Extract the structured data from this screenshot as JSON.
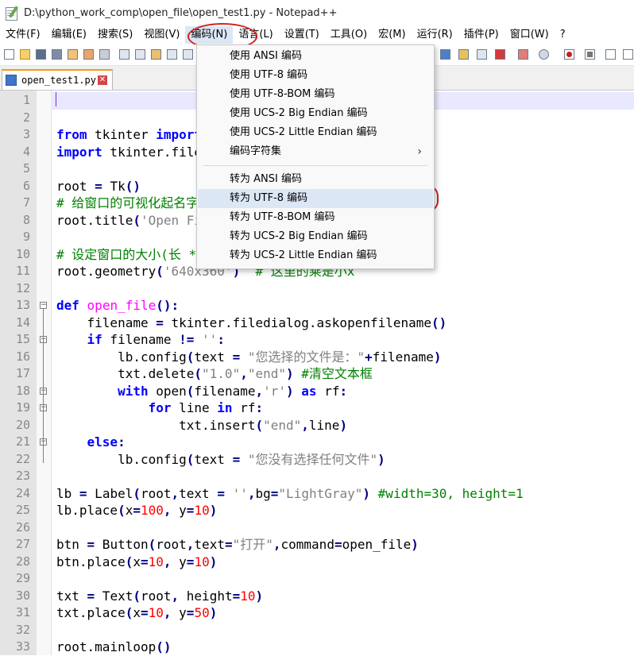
{
  "window": {
    "title": "D:\\python_work_comp\\open_file\\open_test1.py - Notepad++"
  },
  "menubar": {
    "items": [
      {
        "label": "文件(F)"
      },
      {
        "label": "编辑(E)"
      },
      {
        "label": "搜索(S)"
      },
      {
        "label": "视图(V)"
      },
      {
        "label": "编码(N)"
      },
      {
        "label": "语言(L)"
      },
      {
        "label": "设置(T)"
      },
      {
        "label": "工具(O)"
      },
      {
        "label": "宏(M)"
      },
      {
        "label": "运行(R)"
      },
      {
        "label": "插件(P)"
      },
      {
        "label": "窗口(W)"
      },
      {
        "label": "?"
      }
    ]
  },
  "tab": {
    "label": "open_test1.py",
    "close": "✕"
  },
  "encoding_menu": {
    "items": [
      {
        "label": "使用 ANSI 编码"
      },
      {
        "label": "使用 UTF-8 编码"
      },
      {
        "label": "使用 UTF-8-BOM 编码"
      },
      {
        "label": "使用 UCS-2 Big Endian 编码"
      },
      {
        "label": "使用 UCS-2 Little Endian 编码"
      },
      {
        "label": "编码字符集",
        "arrow": "›"
      },
      {
        "label": "转为 ANSI 编码"
      },
      {
        "label": "转为 UTF-8 编码"
      },
      {
        "label": "转为 UTF-8-BOM 编码"
      },
      {
        "label": "转为 UCS-2 Big Endian 编码"
      },
      {
        "label": "转为 UCS-2 Little Endian 编码"
      }
    ]
  },
  "colors": {
    "keyword": "#0000ff",
    "function": "#ff00ff",
    "string": "#808080",
    "number": "#ff0000",
    "comment": "#008000",
    "annotation": "#d32020"
  },
  "editor": {
    "current_line": 1,
    "lines": [
      {
        "n": "1",
        "t": ""
      },
      {
        "n": "2",
        "t": ""
      },
      {
        "n": "3",
        "t": "from tkinter import *"
      },
      {
        "n": "4",
        "t": "import tkinter.filedialog"
      },
      {
        "n": "5",
        "t": ""
      },
      {
        "n": "6",
        "t": "root = Tk()"
      },
      {
        "n": "7",
        "t": "# 给窗口的可视化起名字"
      },
      {
        "n": "8",
        "t": "root.title('Open File')"
      },
      {
        "n": "9",
        "t": ""
      },
      {
        "n": "10",
        "t": "# 设定窗口的大小(长 * 宽)"
      },
      {
        "n": "11",
        "t": "root.geometry('640x360')  # 这里的乘是小x"
      },
      {
        "n": "12",
        "t": ""
      },
      {
        "n": "13",
        "t": "def open_file():"
      },
      {
        "n": "14",
        "t": "    filename = tkinter.filedialog.askopenfilename()"
      },
      {
        "n": "15",
        "t": "    if filename != '':"
      },
      {
        "n": "16",
        "t": "        lb.config(text = \"您选择的文件是：\"+filename)"
      },
      {
        "n": "17",
        "t": "        txt.delete(\"1.0\",\"end\") #清空文本框"
      },
      {
        "n": "18",
        "t": "        with open(filename,'r') as rf:"
      },
      {
        "n": "19",
        "t": "            for line in rf:"
      },
      {
        "n": "20",
        "t": "                txt.insert(\"end\",line)"
      },
      {
        "n": "21",
        "t": "    else:"
      },
      {
        "n": "22",
        "t": "        lb.config(text = \"您没有选择任何文件\")"
      },
      {
        "n": "23",
        "t": ""
      },
      {
        "n": "24",
        "t": "lb = Label(root,text = '',bg=\"LightGray\") #width=30, height=1"
      },
      {
        "n": "25",
        "t": "lb.place(x=100, y=10)"
      },
      {
        "n": "26",
        "t": ""
      },
      {
        "n": "27",
        "t": "btn = Button(root,text=\"打开\",command=open_file)"
      },
      {
        "n": "28",
        "t": "btn.place(x=10, y=10)"
      },
      {
        "n": "29",
        "t": ""
      },
      {
        "n": "30",
        "t": "txt = Text(root, height=10)"
      },
      {
        "n": "31",
        "t": "txt.place(x=10, y=50)"
      },
      {
        "n": "32",
        "t": ""
      },
      {
        "n": "33",
        "t": "root.mainloop()"
      }
    ]
  }
}
